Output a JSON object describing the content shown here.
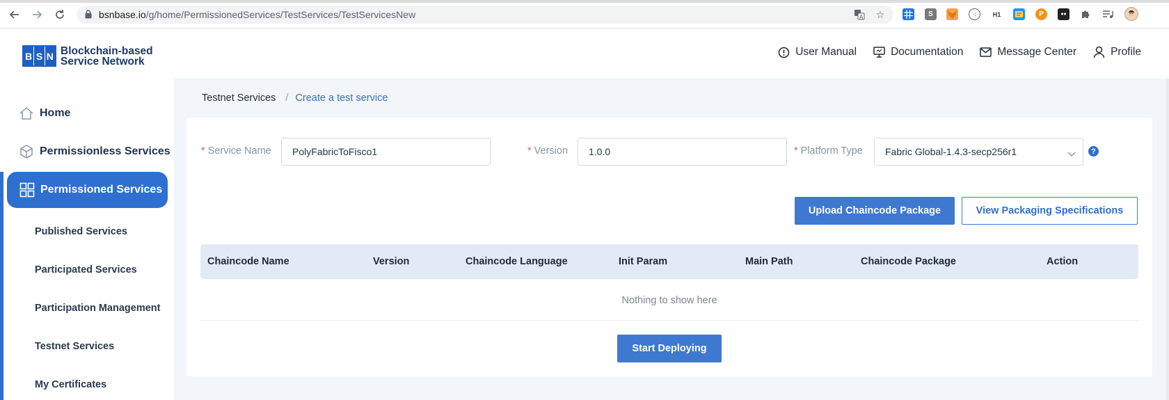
{
  "browser": {
    "url_domain": "bsnbase.io",
    "url_path": "/g/home/PermissionedServices/TestServices/TestServicesNew",
    "back_icon": "arrow-left-icon",
    "forward_icon": "arrow-right-icon",
    "reload_icon": "reload-icon",
    "extensions": [
      "grid-ext",
      "s-ext",
      "fox-ext",
      "circle-ext",
      "h1-ext",
      "bookmark-ext",
      "p-ext",
      "ghost-ext",
      "puzzle-ext",
      "list-ext",
      "avatar-ext"
    ]
  },
  "header": {
    "logo_letters": [
      "B",
      "S",
      "N"
    ],
    "logo_line1": "Blockchain-based",
    "logo_line2": "Service Network",
    "nav": {
      "user_manual": "User Manual",
      "documentation": "Documentation",
      "message_center": "Message Center",
      "profile": "Profile"
    }
  },
  "sidebar": {
    "home": "Home",
    "permissionless": "Permissionless Services",
    "permissioned": "Permissioned Services",
    "sub": {
      "published": "Published Services",
      "participated": "Participated Services",
      "participation_mgmt": "Participation Management",
      "testnet": "Testnet Services",
      "certificates": "My Certificates"
    }
  },
  "breadcrumb": {
    "root": "Testnet Services",
    "separator": "/",
    "current": "Create a test service"
  },
  "form": {
    "required_mark": "*",
    "service_name_label": "Service Name",
    "service_name_value": "PolyFabricToFisco1",
    "version_label": "Version",
    "version_value": "1.0.0",
    "platform_label": "Platform Type",
    "platform_value": "Fabric Global-1.4.3-secp256r1",
    "help": "?"
  },
  "actions": {
    "upload": "Upload Chaincode Package",
    "view_specs": "View Packaging Specifications",
    "start": "Start Deploying"
  },
  "table": {
    "columns": [
      "Chaincode Name",
      "Version",
      "Chaincode Language",
      "Init Param",
      "Main Path",
      "Chaincode Package",
      "Action"
    ],
    "empty_text": "Nothing to show here"
  },
  "colors": {
    "primary": "#3f78d1",
    "sidebar_active": "#2f6fd0",
    "table_header_bg": "#e2eaf6",
    "main_bg": "#f2f5f9"
  }
}
